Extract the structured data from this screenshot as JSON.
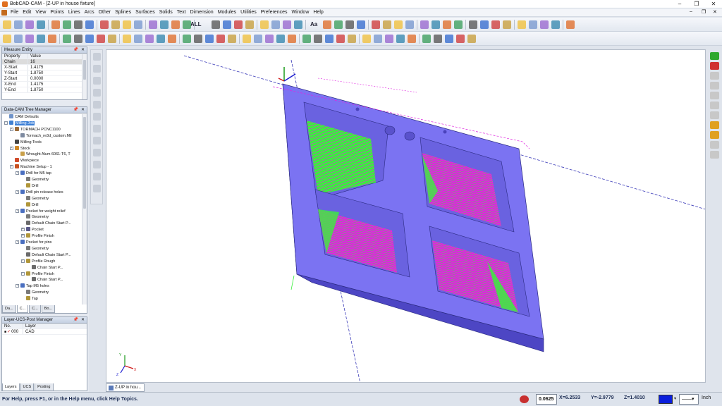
{
  "window": {
    "title": "BobCAD-CAM - [Z-UP in house fixture]",
    "controls": [
      "–",
      "❐",
      "✕"
    ]
  },
  "menu": {
    "items": [
      "File",
      "Edit",
      "View",
      "Points",
      "Lines",
      "Arcs",
      "Other",
      "Splines",
      "Surfaces",
      "Solids",
      "Text",
      "Dimension",
      "Modules",
      "Utilities",
      "Preferences",
      "Window",
      "Help"
    ],
    "mdi_controls": [
      "–",
      "❐",
      "✕"
    ]
  },
  "toolbar": {
    "all_label": "ALL",
    "text_tool_label": "Aa"
  },
  "measure_entity": {
    "title": "Measure Entity",
    "columns": [
      "Property",
      "Value"
    ],
    "rows": [
      {
        "property": "Chain",
        "value": "16"
      },
      {
        "property": "X-Start",
        "value": "1.4175"
      },
      {
        "property": "Y-Start",
        "value": "1.8750"
      },
      {
        "property": "Z-Start",
        "value": "0.0000"
      },
      {
        "property": "X-End",
        "value": "1.4175"
      },
      {
        "property": "Y-End",
        "value": "1.8750"
      }
    ]
  },
  "tree_manager": {
    "title": "Data-CAM Tree Manager",
    "items": [
      {
        "label": "CAM Defaults",
        "icon": "folder-icon",
        "color": "#6f93c9"
      },
      {
        "label": "Milling Job",
        "icon": "job-icon",
        "color": "#3f7fd0"
      },
      {
        "label": "TORMACH PCNC1100",
        "icon": "machine-icon",
        "color": "#9a6b3a"
      },
      {
        "label": "Tormach_re3d_custom.Mil",
        "icon": "post-icon",
        "color": "#7d8aa0"
      },
      {
        "label": "Milling Tools",
        "icon": "tool-icon",
        "color": "#444444"
      },
      {
        "label": "Stock",
        "icon": "stock-icon",
        "color": "#d08a2a"
      },
      {
        "label": "Wrought Alum 6061-T6, T",
        "icon": "material-icon",
        "color": "#c9a04a"
      },
      {
        "label": "Workpiece",
        "icon": "workpiece-icon",
        "color": "#d04a2a"
      },
      {
        "label": "Machine Setup - 1",
        "icon": "setup-icon",
        "color": "#c85020"
      },
      {
        "label": "Drill for M5 tap",
        "icon": "drill-feature-icon",
        "color": "#4a6fc0"
      },
      {
        "label": "Geometry",
        "icon": "geometry-icon",
        "color": "#7a7a7a"
      },
      {
        "label": "Drill",
        "icon": "drill-icon",
        "color": "#b0963a"
      },
      {
        "label": "Drill pin release holes",
        "icon": "drill-feature-icon",
        "color": "#4a6fc0"
      },
      {
        "label": "Geometry",
        "icon": "geometry-icon",
        "color": "#7a7a7a"
      },
      {
        "label": "Drill",
        "icon": "drill-icon",
        "color": "#b0963a"
      },
      {
        "label": "Pocket for weight relief",
        "icon": "pocket-feature-icon",
        "color": "#4a6fc0"
      },
      {
        "label": "Geometry",
        "icon": "geometry-icon",
        "color": "#7a7a7a"
      },
      {
        "label": "Default Chain Start P...",
        "icon": "chain-start-icon",
        "color": "#6a6a6a"
      },
      {
        "label": "Pocket",
        "icon": "pocket-icon",
        "color": "#5a5a8a"
      },
      {
        "label": "Profile Finish",
        "icon": "profile-icon",
        "color": "#b0963a"
      },
      {
        "label": "Pocket for pins",
        "icon": "pocket-feature-icon",
        "color": "#4a6fc0"
      },
      {
        "label": "Geometry",
        "icon": "geometry-icon",
        "color": "#7a7a7a"
      },
      {
        "label": "Default Chain Start P...",
        "icon": "chain-start-icon",
        "color": "#6a6a6a"
      },
      {
        "label": "Profile Rough",
        "icon": "profile-icon",
        "color": "#b0963a"
      },
      {
        "label": "Chain Start P...",
        "icon": "chain-start-icon",
        "color": "#6a6a6a"
      },
      {
        "label": "Profile Finish",
        "icon": "profile-icon",
        "color": "#b0963a"
      },
      {
        "label": "Chain Start P...",
        "icon": "chain-start-icon",
        "color": "#6a6a6a"
      },
      {
        "label": "Tap M5 holes",
        "icon": "tap-feature-icon",
        "color": "#4a6fc0"
      },
      {
        "label": "Geometry",
        "icon": "geometry-icon",
        "color": "#7a7a7a"
      },
      {
        "label": "Tap",
        "icon": "tap-icon",
        "color": "#b0963a"
      }
    ],
    "tabs": [
      "Da...",
      "C...",
      "C...",
      "Bo..."
    ]
  },
  "layer_manager": {
    "title": "Layer-UCS-Post Manager",
    "columns": [
      "No.",
      "Layer"
    ],
    "rows": [
      {
        "no": "000",
        "layer": "CAD"
      }
    ],
    "tabs": [
      "Layers",
      "UCS",
      "Posting"
    ]
  },
  "document_tab": "Z-UP in hou...",
  "status": {
    "help_text": "For Help, press F1, or in the Help menu, click Help Topics.",
    "step_value": "0.0625",
    "x": "X=6.2533",
    "y": "Y=-2.9779",
    "z": "Z=1.4010",
    "units": "Inch",
    "color_swatch": "#0a1edc"
  },
  "colors": {
    "part_face": "#7b73f2",
    "part_side": "#5e57d8",
    "toolpath_green": "#39f03c",
    "toolpath_magenta": "#e024e0",
    "axis_line": "#3a3ab8"
  }
}
